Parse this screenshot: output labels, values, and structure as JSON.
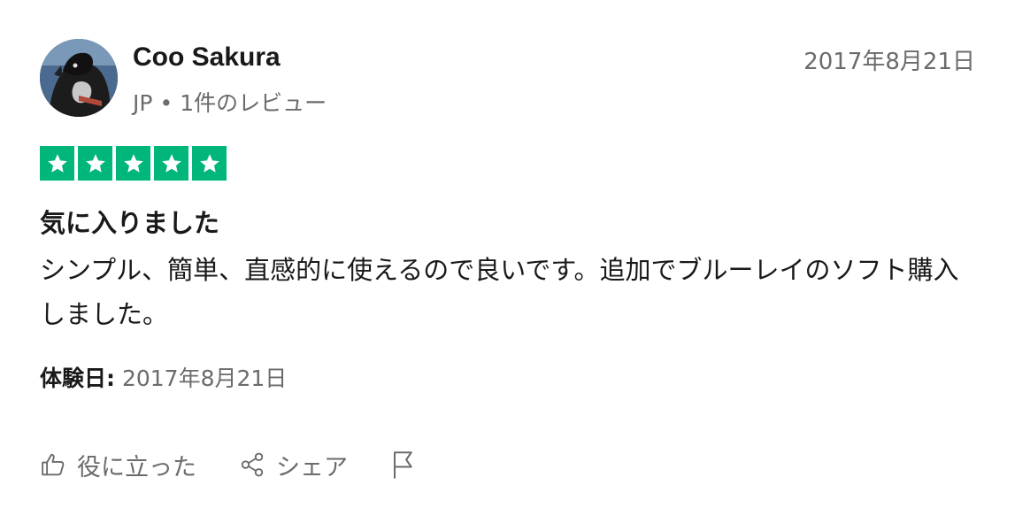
{
  "review": {
    "reviewer": {
      "name": "Coo Sakura",
      "country": "JP",
      "separator": "•",
      "review_count": "1件のレビュー"
    },
    "date": "2017年8月21日",
    "rating": 5,
    "rating_color": "#00b67a",
    "title": "気に入りました",
    "body": "シンプル、簡単、直感的に使えるので良いです。追加でブルーレイのソフト購入しました。",
    "experience": {
      "label": "体験日:",
      "date": "2017年8月21日"
    }
  },
  "actions": {
    "useful": {
      "label": "役に立った",
      "icon": "thumbs-up-icon"
    },
    "share": {
      "label": "シェア",
      "icon": "share-icon"
    },
    "report": {
      "icon": "flag-icon"
    }
  }
}
